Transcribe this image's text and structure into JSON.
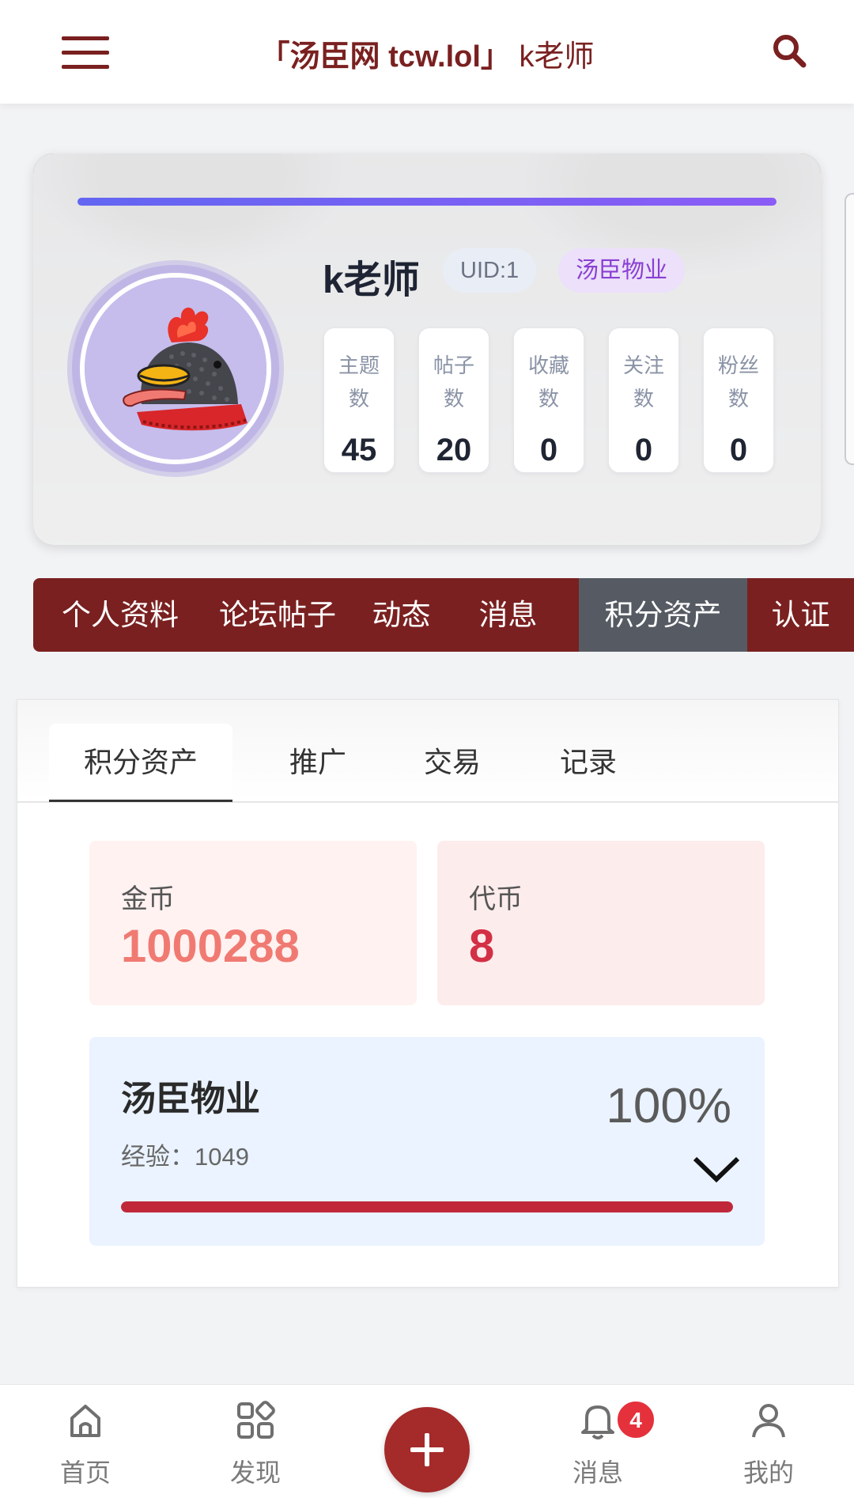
{
  "header": {
    "title_site": "「汤臣网 tcw.lol」",
    "title_user": "k老师",
    "menu_icon": "hamburger-menu-icon",
    "search_icon": "search-icon"
  },
  "profile": {
    "name": "k老师",
    "uid": "UID:1",
    "role": "汤臣物业",
    "top_progress": 1.0,
    "stats": [
      {
        "label": "主题数",
        "value": "45"
      },
      {
        "label": "帖子数",
        "value": "20"
      },
      {
        "label": "收藏数",
        "value": "0"
      },
      {
        "label": "关注数",
        "value": "0"
      },
      {
        "label": "粉丝数",
        "value": "0"
      }
    ]
  },
  "main_tabs": [
    {
      "label": "个人资料",
      "active": false
    },
    {
      "label": "论坛帖子",
      "active": false
    },
    {
      "label": "动态",
      "active": false
    },
    {
      "label": "消息",
      "active": false
    },
    {
      "label": "积分资产",
      "active": true
    },
    {
      "label": "认证",
      "active": false
    }
  ],
  "assets": {
    "sub_tabs": [
      {
        "label": "积分资产",
        "active": true
      },
      {
        "label": "推广",
        "active": false
      },
      {
        "label": "交易",
        "active": false
      },
      {
        "label": "记录",
        "active": false
      }
    ],
    "gold": {
      "label": "金币",
      "value": "1000288"
    },
    "token": {
      "label": "代币",
      "value": "8"
    },
    "level": {
      "name": "汤臣物业",
      "exp": "经验：1049",
      "percent_text": "100%",
      "progress": 1.0
    }
  },
  "bottom_nav": {
    "items": [
      {
        "label": "首页",
        "icon": "home-icon"
      },
      {
        "label": "发现",
        "icon": "discover-grid-icon"
      },
      {
        "label": "消息",
        "icon": "bell-icon"
      },
      {
        "label": "我的",
        "icon": "user-icon"
      }
    ],
    "add_icon": "plus-icon",
    "message_badge": "4"
  },
  "colors": {
    "brand": "#7a2020",
    "active_tab": "#565b63",
    "gold_text": "#f07a72",
    "token_text": "#d33045",
    "level_bar": "#c0283a",
    "accent_purple": "#8b5cf6"
  }
}
